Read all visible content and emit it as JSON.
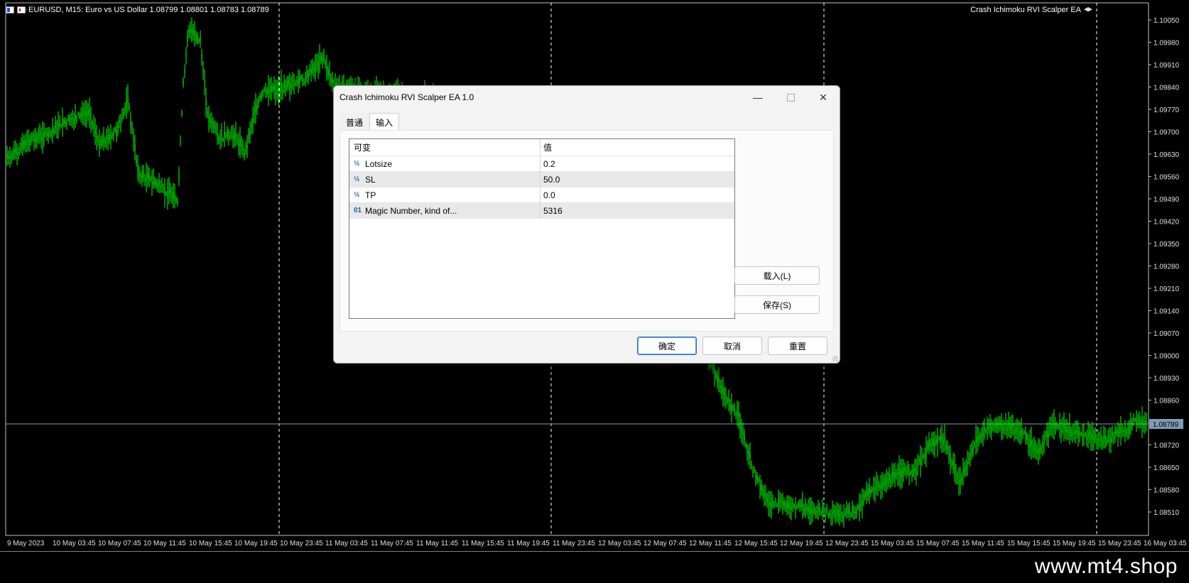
{
  "chart": {
    "symbol_header": "EURUSD, M15:  Euro vs US Dollar  1.08799 1.08801 1.08783 1.08789",
    "ea_name": "Crash Ichimoku RVI Scalper EA",
    "current_price": "1.08789",
    "price_labels": [
      "1.10050",
      "1.09980",
      "1.09910",
      "1.09840",
      "1.09770",
      "1.09700",
      "1.09630",
      "1.09560",
      "1.09490",
      "1.09420",
      "1.09350",
      "1.09280",
      "1.09210",
      "1.09140",
      "1.09070",
      "1.09000",
      "1.08930",
      "1.08860",
      "1.08790",
      "1.08720",
      "1.08650",
      "1.08580",
      "1.08510"
    ],
    "time_labels": [
      "9 May 2023",
      "10 May 03:45",
      "10 May 07:45",
      "10 May 11:45",
      "10 May 15:45",
      "10 May 19:45",
      "10 May 23:45",
      "11 May 03:45",
      "11 May 07:45",
      "11 May 11:45",
      "11 May 15:45",
      "11 May 19:45",
      "11 May 23:45",
      "12 May 03:45",
      "12 May 07:45",
      "12 May 11:45",
      "12 May 15:45",
      "12 May 19:45",
      "12 May 23:45",
      "15 May 03:45",
      "15 May 07:45",
      "15 May 11:45",
      "15 May 15:45",
      "15 May 19:45",
      "15 May 23:45",
      "16 May 03:45"
    ],
    "colors": {
      "candle": "#00ff00",
      "background": "#000000",
      "price_line": "#7f9bb5",
      "grid": "#ffffff"
    }
  },
  "dialog": {
    "title": "Crash Ichimoku RVI Scalper EA 1.0",
    "minimize": "—",
    "close": "✕",
    "tabs": [
      "普通",
      "输入"
    ],
    "active_tab": "输入",
    "grid": {
      "headers": [
        "可变",
        "值"
      ],
      "rows": [
        {
          "icon": "½",
          "name": "Lotsize",
          "value": "0.2"
        },
        {
          "icon": "½",
          "name": "SL",
          "value": "50.0"
        },
        {
          "icon": "½",
          "name": "TP",
          "value": "0.0"
        },
        {
          "icon": "01",
          "name": "Magic Number, kind of...",
          "value": "5316"
        }
      ]
    },
    "buttons": {
      "load": "载入(L)",
      "save": "保存(S)",
      "ok": "确定",
      "cancel": "取消",
      "reset": "重置"
    }
  },
  "watermark": "www.mt4.shop"
}
